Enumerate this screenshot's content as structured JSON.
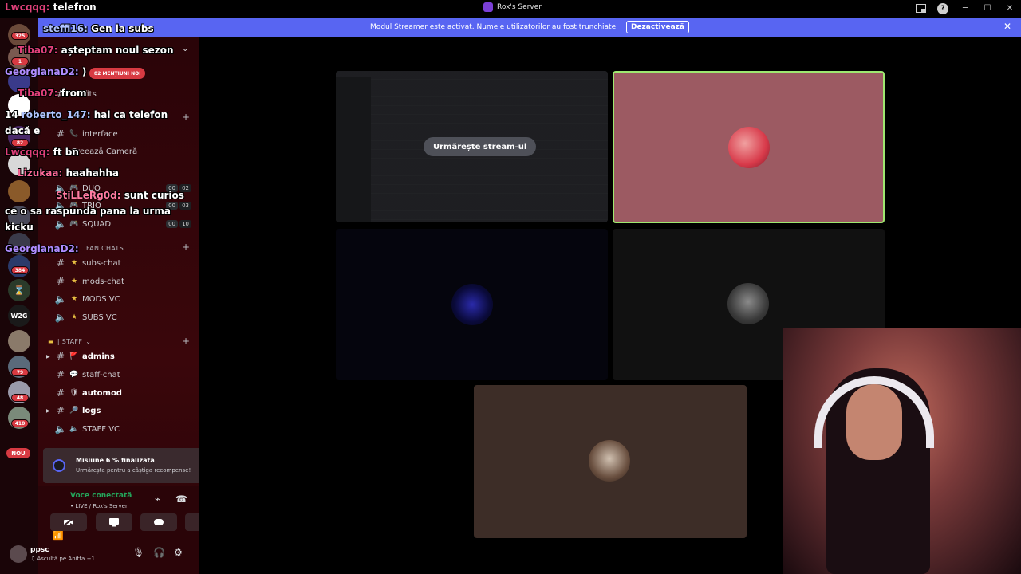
{
  "titlebar": {
    "server_name": "Rox's Server",
    "icons": [
      "inbox-icon",
      "help-icon",
      "minimize-icon",
      "maximize-icon",
      "close-icon"
    ],
    "help_glyph": "?",
    "minimize_glyph": "─",
    "maximize_glyph": "☐",
    "close_glyph": "✕"
  },
  "banner": {
    "text": "Modul Streamer este activat. Numele utilizatorilor au fost trunchiate.",
    "button_label": "Dezactivează",
    "close_glyph": "✕"
  },
  "server_rail": {
    "badges": [
      "325",
      "1",
      "82",
      "384",
      "79",
      "48",
      "410"
    ],
    "new_label": "NOU"
  },
  "sidebar": {
    "mentions_pill": "82 MENȚIUNI NOI",
    "chevron": "⌄",
    "channels_top": [
      {
        "name": "outfits",
        "type": "text"
      },
      {
        "name": "interface",
        "type": "text",
        "emoji": "📞"
      },
      {
        "name": "Creează Cameră",
        "type": "create"
      },
      {
        "name": "DUO",
        "type": "voice",
        "counts": [
          "00",
          "02"
        ]
      },
      {
        "name": "TRIO",
        "type": "voice",
        "counts": [
          "00",
          "03"
        ]
      },
      {
        "name": "SQUAD",
        "type": "voice",
        "counts": [
          "00",
          "10"
        ]
      }
    ],
    "category_fan": "FAN CHATS",
    "channels_fan": [
      {
        "name": "subs-chat",
        "type": "text",
        "emoji": "★"
      },
      {
        "name": "mods-chat",
        "type": "text",
        "emoji": "★"
      },
      {
        "name": "MODS VC",
        "type": "voice",
        "emoji": "★"
      },
      {
        "name": "SUBS VC",
        "type": "voice",
        "emoji": "★"
      }
    ],
    "category_staff": "| STAFF",
    "channels_staff": [
      {
        "name": "admins",
        "type": "text",
        "emoji": "🚩",
        "bold": true
      },
      {
        "name": "staff-chat",
        "type": "text",
        "emoji": "💬"
      },
      {
        "name": "automod",
        "type": "text",
        "emoji": "🛡",
        "bold": true
      },
      {
        "name": "logs",
        "type": "text",
        "emoji": "🔎",
        "bold": true
      },
      {
        "name": "STAFF VC",
        "type": "voice",
        "emoji": "🔈"
      }
    ]
  },
  "mission": {
    "title": "Misiune 6 % finalizată",
    "subtitle": "Urmărește pentru a câștiga recompense!"
  },
  "voice": {
    "status": "Voce conectată",
    "channel": "• LIVE / Rox's Server"
  },
  "user": {
    "name": "ppsc",
    "status": "♫ Ascultă pe Anitta +1"
  },
  "stream": {
    "watch_label": "Urmărește stream-ul"
  },
  "chat_messages": [
    {
      "user": "Lwcqqq:",
      "text": "telefron",
      "color": "#e0407a"
    },
    {
      "user": "steffi16:",
      "text": "Gen la subs",
      "color": "#b0c4ff"
    },
    {
      "user": "Tiba07:",
      "text": "așteptam noul sezon",
      "color": "#e0407a"
    },
    {
      "user": "GeorgianaD2:",
      "text": ")",
      "color": "#b08cff"
    },
    {
      "user": "Tiba07:",
      "text": "from",
      "color": "#e0407a"
    },
    {
      "user": "roberto_147:",
      "text": "hai ca telefon",
      "color": "#b0c4ff"
    },
    {
      "user": "",
      "text": "dacă e",
      "color": "#ffffff"
    },
    {
      "user": "Lwcqqq:",
      "text": "ft bn",
      "color": "#e0407a"
    },
    {
      "user": "Lizukaa:",
      "text": "haahahha",
      "color": "#ff6a9a"
    },
    {
      "user": "StiLLeRg0d:",
      "text": "sunt curios",
      "color": "#ff7aa0"
    },
    {
      "user": "",
      "text": "ce o sa raspunda pana la urma",
      "color": "#ffffff"
    },
    {
      "user": "",
      "text": "kicku",
      "color": "#ffffff"
    },
    {
      "user": "GeorgianaD2:",
      "text": "",
      "color": "#b08cff"
    }
  ],
  "chat_prefix": "14"
}
